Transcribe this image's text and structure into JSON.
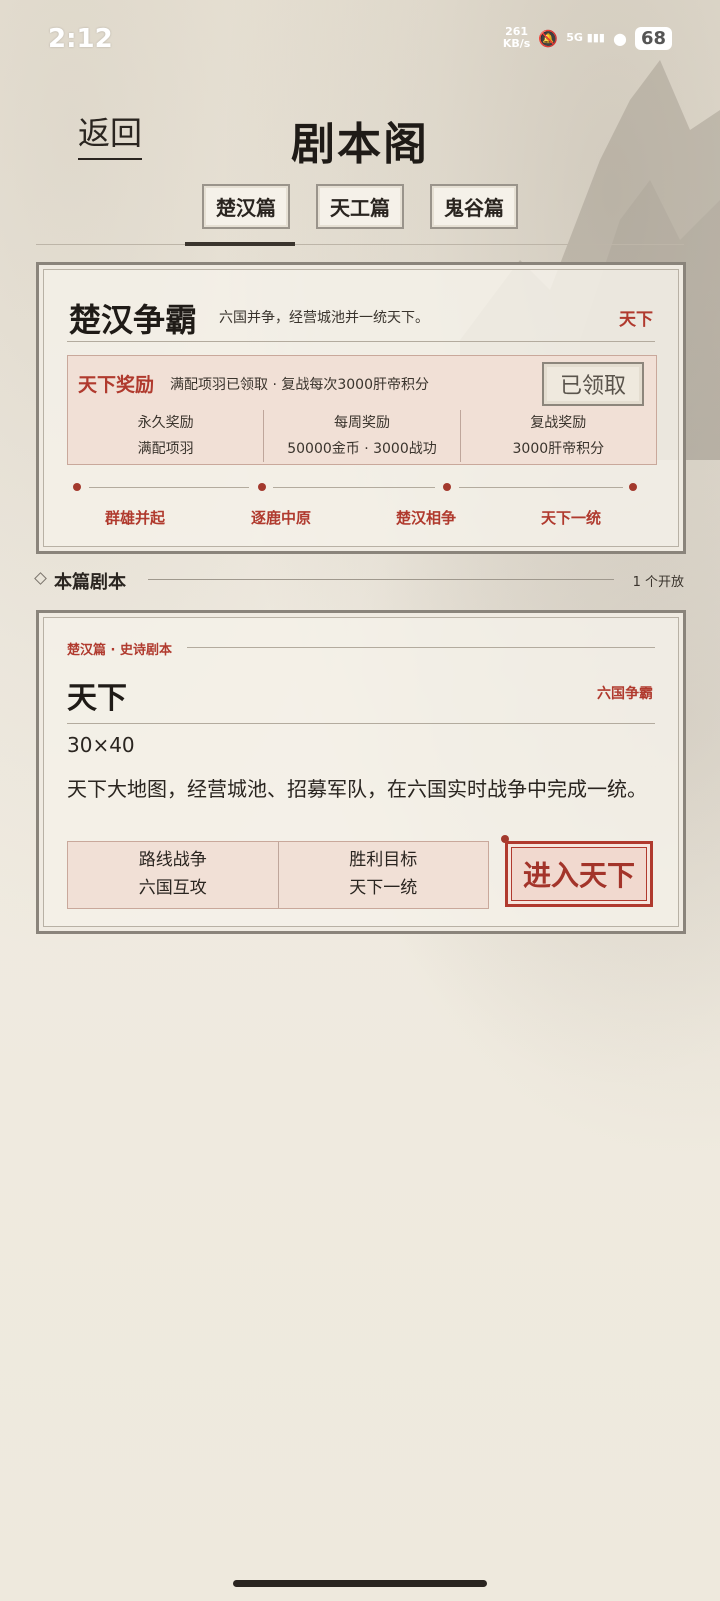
{
  "status_bar": {
    "time": "2:12",
    "net_speed": "261",
    "net_unit": "KB/s",
    "signal": "5G",
    "battery": "68"
  },
  "header": {
    "back_label": "返回",
    "title": "剧本阁"
  },
  "tabs": [
    {
      "label": "楚汉篇",
      "active": true
    },
    {
      "label": "天工篇",
      "active": false
    },
    {
      "label": "鬼谷篇",
      "active": false
    }
  ],
  "chapter_card": {
    "title": "楚汉争霸",
    "description": "六国并争，经营城池并一统天下。",
    "tag": "天下",
    "reward": {
      "title": "天下奖励",
      "description": "满配项羽已领取 · 复战每次3000肝帝积分",
      "claim_button": "已领取",
      "columns": [
        {
          "label": "永久奖励",
          "value": "满配项羽"
        },
        {
          "label": "每周奖励",
          "value": "50000金币 · 3000战功"
        },
        {
          "label": "复战奖励",
          "value": "3000肝帝积分"
        }
      ]
    },
    "stages": [
      "群雄并起",
      "逐鹿中原",
      "楚汉相争",
      "天下一统"
    ]
  },
  "section": {
    "title": "本篇剧本",
    "count": "1 个开放"
  },
  "scenario_card": {
    "subtitle": "楚汉篇 · 史诗剧本",
    "title": "天下",
    "tag": "六国争霸",
    "size": "30×40",
    "description": "天下大地图，经营城池、招募军队，在六国实时战争中完成一统。",
    "info": [
      {
        "label": "路线战争",
        "value": "六国互攻"
      },
      {
        "label": "胜利目标",
        "value": "天下一统"
      }
    ],
    "enter_button": "进入天下"
  },
  "colors": {
    "accent_red": "#b03a2e",
    "paper": "#efe9dd",
    "ink": "#2a2520"
  }
}
